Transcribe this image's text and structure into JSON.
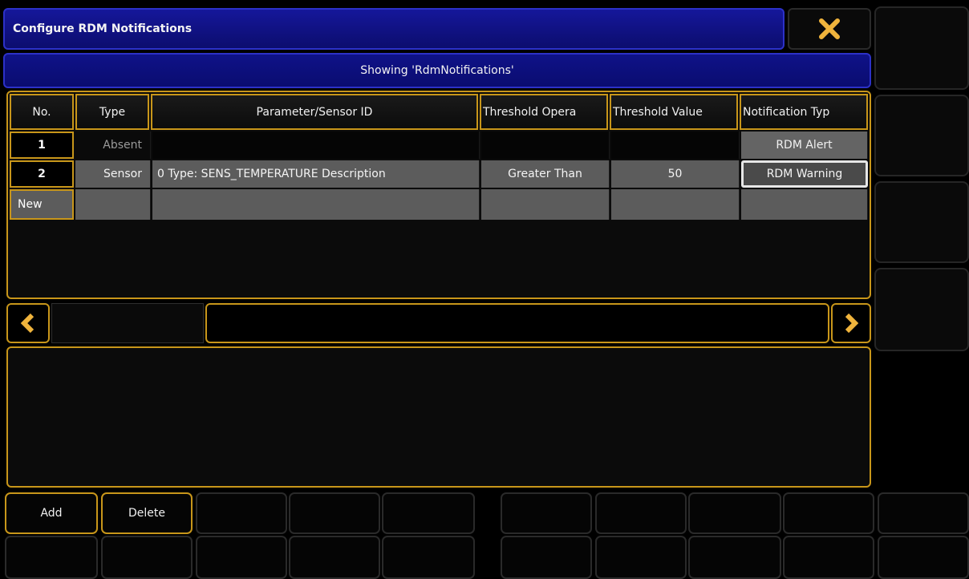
{
  "window": {
    "title": "Configure RDM Notifications",
    "subtitle": "Showing 'RdmNotifications'"
  },
  "table": {
    "headers": [
      "No.",
      "Type",
      "Parameter/Sensor ID",
      "Threshold Opera",
      "Threshold Value",
      "Notification Typ"
    ],
    "rows": [
      {
        "no": "1",
        "type": "Absent",
        "param": "",
        "operator": "",
        "value": "",
        "notification": "RDM Alert"
      },
      {
        "no": "2",
        "type": "Sensor",
        "param": "0 Type: SENS_TEMPERATURE Description",
        "operator": "Greater Than",
        "value": "50",
        "notification": "RDM Warning"
      }
    ],
    "new_row_label": "New"
  },
  "buttons": {
    "add": "Add",
    "delete": "Delete"
  },
  "colors": {
    "accent_gold": "#c8961a",
    "title_blue": "#15179a",
    "close_icon": "#f0b43c",
    "selected_border": "#e6e6e6"
  },
  "icons": {
    "close": "close-icon",
    "scroll_left": "chevron-left-icon",
    "scroll_right": "chevron-right-icon"
  }
}
